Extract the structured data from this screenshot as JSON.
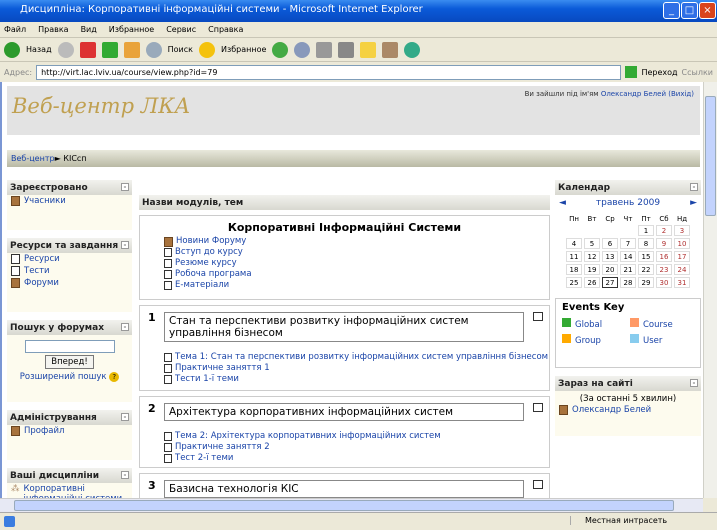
{
  "window": {
    "title": "Дисципліна: Корпоративні інформаційні системи - Microsoft Internet Explorer"
  },
  "menu": [
    "Файл",
    "Правка",
    "Вид",
    "Избранное",
    "Сервис",
    "Справка"
  ],
  "toolbar": {
    "back": "Назад",
    "search": "Поиск",
    "favorites": "Избранное"
  },
  "address": {
    "label": "Адрес:",
    "url": "http://virt.lac.lviv.ua/course/view.php?id=79",
    "go": "Переход",
    "links": "Ссылки"
  },
  "header": {
    "logo": "Веб-центр ЛКА",
    "login_prefix": "Ви зайшли під ім'ям",
    "user": "Олександр Белей",
    "logout": "(Вихід)"
  },
  "breadcrumb": {
    "home": "Веб-центр",
    "sep": "►",
    "current": "КІСсп"
  },
  "left": [
    {
      "title": "Зареєстровано",
      "items": [
        "Учасники"
      ]
    },
    {
      "title": "Ресурси та завдання",
      "items": [
        "Ресурси",
        "Тести",
        "Форуми"
      ]
    },
    {
      "title": "Пошук у форумах",
      "button": "Вперед!",
      "advanced": "Розширений пошук"
    },
    {
      "title": "Адміністрування",
      "items": [
        "Профайл"
      ]
    },
    {
      "title": "Ваші дисципліни",
      "items": [
        "Корпоративні інформаційні системи"
      ]
    }
  ],
  "center": {
    "header": "Назви модулів, тем",
    "course_title": "Корпоративні Інформаційні Системи",
    "intro": [
      "Новини Форуму",
      "Вступ до курсу",
      "Резюме курсу",
      "Робоча програма",
      "Е-матеріали"
    ],
    "sections": [
      {
        "num": "1",
        "title": "Стан та перспективи розвитку інформаційних систем управління бізнесом",
        "items": [
          "Тема 1: Стан та перспективи розвитку інформаційних систем управління бізнесом",
          "Практичне заняття 1",
          "Тести 1-ї теми"
        ]
      },
      {
        "num": "2",
        "title": "Архітектура корпоративних інформаційних систем",
        "items": [
          "Тема 2: Архітектура корпоративних інформаційних систем",
          "Практичне заняття 2",
          "Тест 2-ї теми"
        ]
      },
      {
        "num": "3",
        "title": "Базисна технологія КІС",
        "items": []
      }
    ]
  },
  "calendar": {
    "title": "Календар",
    "month": "травень 2009",
    "days": [
      "Пн",
      "Вт",
      "Ср",
      "Чт",
      "Пт",
      "Сб",
      "Нд"
    ],
    "weeks": [
      [
        "",
        "",
        "",
        "",
        "1",
        "2",
        "3"
      ],
      [
        "4",
        "5",
        "6",
        "7",
        "8",
        "9",
        "10"
      ],
      [
        "11",
        "12",
        "13",
        "14",
        "15",
        "16",
        "17"
      ],
      [
        "18",
        "19",
        "20",
        "21",
        "22",
        "23",
        "24"
      ],
      [
        "25",
        "26",
        "27",
        "28",
        "29",
        "30",
        "31"
      ]
    ],
    "today": "27"
  },
  "events": {
    "title": "Events Key",
    "items": [
      "Global",
      "Course",
      "Group",
      "User"
    ],
    "colors": [
      "#33aa33",
      "#ff9966",
      "#ffaa00",
      "#88ccee"
    ]
  },
  "online": {
    "title": "Зараз на сайті",
    "period": "(За останні 5 хвилин)",
    "users": [
      "Олександр Белей"
    ]
  },
  "status": {
    "zone": "Местная интрасеть"
  }
}
